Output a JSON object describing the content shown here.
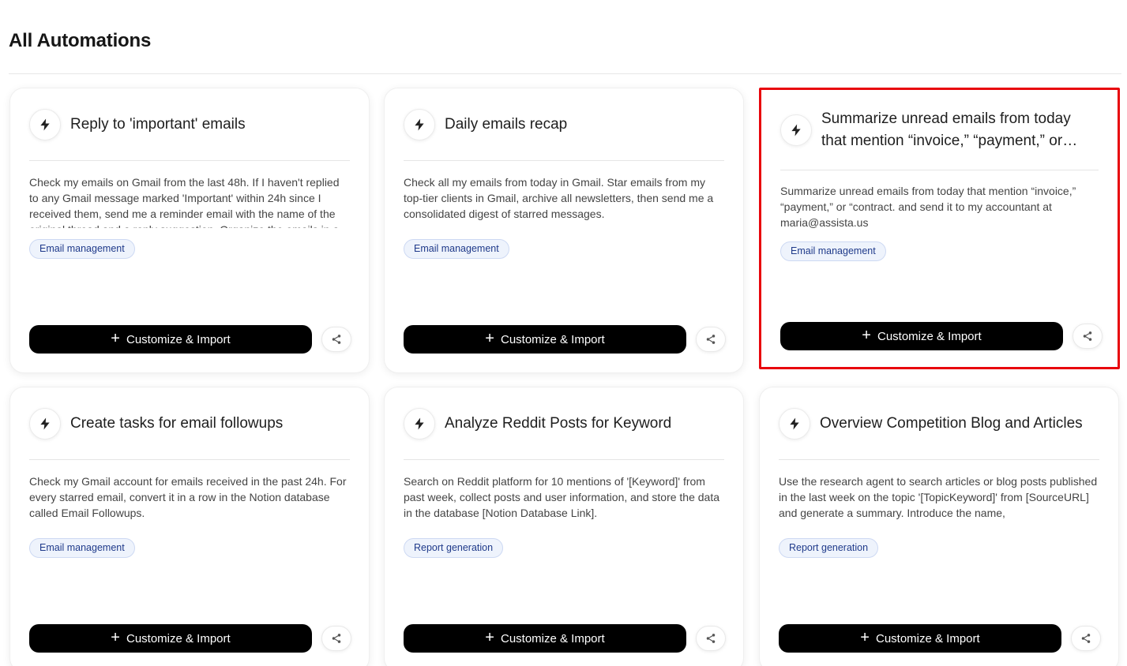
{
  "page": {
    "title": "All Automations"
  },
  "colors": {
    "highlight_border": "#e8060d",
    "button_bg": "#000000",
    "tag_bg": "#eef3fc",
    "tag_text": "#1f3a8a"
  },
  "icons": {
    "card_badge": "bolt-icon",
    "share": "share-icon",
    "button_prefix": "plus-icon"
  },
  "cards": [
    {
      "title": "Reply to 'important' emails",
      "description": "Check my emails on Gmail from the last 48h. If I haven't replied to any Gmail message marked 'Important' within 24h since I received them, send me a reminder email with the name of the original thread and a reply suggestion. Organize the emails in a",
      "tag": "Email management",
      "button_label": "Customize & Import",
      "highlighted": false
    },
    {
      "title": "Daily emails recap",
      "description": "Check all my emails from today in Gmail. Star emails from my top-tier clients in Gmail, archive all newsletters, then send me a consolidated digest of starred messages.",
      "tag": "Email management",
      "button_label": "Customize & Import",
      "highlighted": false
    },
    {
      "title": "Summarize unread emails from today that mention “invoice,” “payment,” or “contract.”",
      "description": "Summarize unread emails from today that mention “invoice,” “payment,” or “contract. and send it to my accountant at maria@assista.us",
      "tag": "Email management",
      "button_label": "Customize & Import",
      "highlighted": true
    },
    {
      "title": "Create tasks for email followups",
      "description": "Check my Gmail account for emails received in the past 24h. For every starred email, convert it in a row in the Notion database called Email Followups.",
      "tag": "Email management",
      "button_label": "Customize & Import",
      "highlighted": false
    },
    {
      "title": "Analyze Reddit Posts for Keyword",
      "description": "Search on Reddit platform for 10 mentions of '[Keyword]' from past week, collect posts and user information, and store the data in the database [Notion Database Link].",
      "tag": "Report generation",
      "button_label": "Customize & Import",
      "highlighted": false
    },
    {
      "title": "Overview Competition Blog and Articles",
      "description": "Use the research agent to search articles or blog posts published in the last week on the topic '[TopicKeyword]' from [SourceURL] and generate a summary. Introduce the name,",
      "tag": "Report generation",
      "button_label": "Customize & Import",
      "highlighted": false
    }
  ]
}
